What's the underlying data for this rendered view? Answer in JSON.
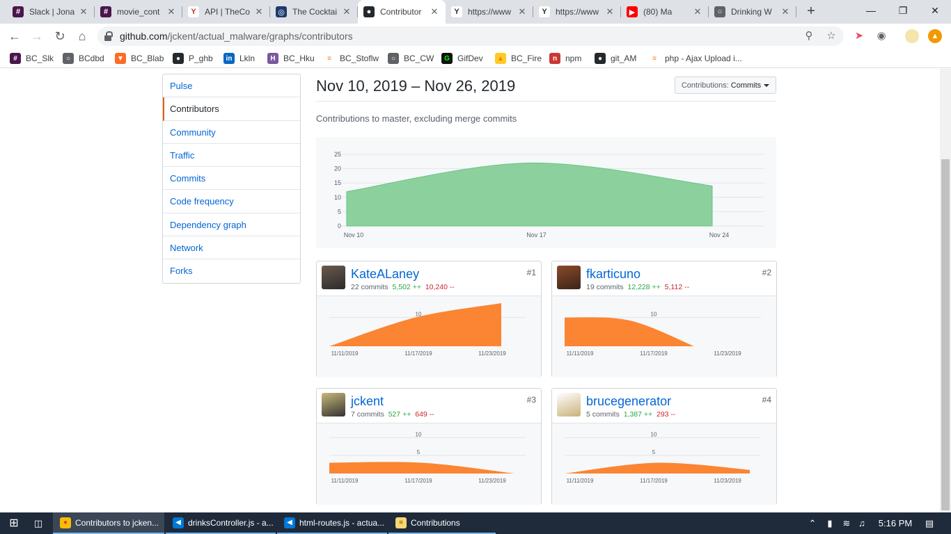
{
  "browser": {
    "tabs": [
      {
        "title": "Slack | Jona",
        "icon": "slack-icon",
        "x": 10,
        "w": 126,
        "active": false
      },
      {
        "title": "movie_cont",
        "icon": "slack-icon",
        "x": 136,
        "w": 126,
        "active": false
      },
      {
        "title": "API | TheCo",
        "icon": "cocktail-icon",
        "x": 262,
        "w": 126,
        "active": false
      },
      {
        "title": "The Cocktai",
        "icon": "cocktail-db-icon",
        "x": 388,
        "w": 126,
        "active": false
      },
      {
        "title": "Contributor",
        "icon": "github-icon",
        "x": 514,
        "w": 126,
        "active": true
      },
      {
        "title": "https://www",
        "icon": "cocktail-glass-icon",
        "x": 640,
        "w": 126,
        "active": false
      },
      {
        "title": "https://www",
        "icon": "cocktail-glass-icon",
        "x": 766,
        "w": 126,
        "active": false
      },
      {
        "title": "(80) Ma",
        "icon": "youtube-icon",
        "x": 892,
        "w": 126,
        "active": false
      },
      {
        "title": "Drinking W",
        "icon": "globe-icon",
        "x": 1018,
        "w": 126,
        "active": false
      }
    ],
    "url_host": "github.com",
    "url_path": "/jckent/actual_malware/graphs/contributors",
    "bookmarks": [
      {
        "label": "BC_Slk",
        "icon": "slack-icon",
        "x": 14
      },
      {
        "label": "BCdbd",
        "icon": "globe-icon",
        "x": 90
      },
      {
        "label": "BC_Blab",
        "icon": "gitlab-icon",
        "x": 165
      },
      {
        "label": "P_ghb",
        "icon": "github-icon",
        "x": 248
      },
      {
        "label": "Lkln",
        "icon": "linkedin-icon",
        "x": 321
      },
      {
        "label": "BC_Hku",
        "icon": "heroku-icon",
        "x": 384
      },
      {
        "label": "BC_Stoflw",
        "icon": "stackoverflow-icon",
        "x": 465
      },
      {
        "label": "BC_CW",
        "icon": "globe-icon",
        "x": 557
      },
      {
        "label": "GifDev",
        "icon": "gif-icon",
        "x": 634
      },
      {
        "label": "BC_Fire",
        "icon": "firebase-icon",
        "x": 711
      },
      {
        "label": "npm",
        "icon": "npm-icon",
        "x": 789
      },
      {
        "label": "git_AM",
        "icon": "github-icon",
        "x": 854
      },
      {
        "label": "php - Ajax Upload i...",
        "icon": "stackoverflow-icon",
        "x": 932
      }
    ]
  },
  "sidebar": {
    "items": [
      {
        "label": "Pulse",
        "selected": false
      },
      {
        "label": "Contributors",
        "selected": true
      },
      {
        "label": "Community",
        "selected": false
      },
      {
        "label": "Traffic",
        "selected": false
      },
      {
        "label": "Commits",
        "selected": false
      },
      {
        "label": "Code frequency",
        "selected": false
      },
      {
        "label": "Dependency graph",
        "selected": false
      },
      {
        "label": "Network",
        "selected": false
      },
      {
        "label": "Forks",
        "selected": false
      }
    ]
  },
  "main": {
    "date_range": "Nov 10, 2019 – Nov 26, 2019",
    "dropdown_prefix": "Contributions: ",
    "dropdown_value": "Commits",
    "subtitle": "Contributions to master, excluding merge commits"
  },
  "chart_data": [
    {
      "type": "area",
      "title": "",
      "x": [
        "Nov 10",
        "Nov 17",
        "Nov 24"
      ],
      "y": [
        12,
        22,
        14
      ],
      "yticks": [
        0,
        5,
        10,
        15,
        20,
        25
      ],
      "ylim": [
        0,
        25
      ],
      "color": "#8cd19d"
    },
    {
      "type": "area",
      "name": "KateALaney",
      "x": [
        "11/11/2019",
        "11/17/2019",
        "11/23/2019"
      ],
      "y": [
        0,
        10,
        15
      ],
      "yticks": [
        10
      ],
      "ylim": [
        0,
        15
      ],
      "color": "#fb8532"
    },
    {
      "type": "area",
      "name": "fkarticuno",
      "x": [
        "11/11/2019",
        "11/17/2019",
        "11/23/2019"
      ],
      "y": [
        10,
        9,
        0
      ],
      "yticks": [
        10
      ],
      "ylim": [
        0,
        15
      ],
      "color": "#fb8532"
    },
    {
      "type": "area",
      "name": "jckent",
      "x": [
        "11/11/2019",
        "11/17/2019",
        "11/23/2019"
      ],
      "y": [
        3,
        3,
        0
      ],
      "yticks": [
        10,
        5
      ],
      "ylim": [
        0,
        12
      ],
      "color": "#fb8532"
    },
    {
      "type": "area",
      "name": "brucegenerator",
      "x": [
        "11/11/2019",
        "11/17/2019",
        "11/23/2019"
      ],
      "y": [
        0,
        3,
        1
      ],
      "yticks": [
        10,
        5
      ],
      "ylim": [
        0,
        12
      ],
      "color": "#fb8532"
    }
  ],
  "contributors": [
    {
      "rank": "#1",
      "login": "KateALaney",
      "commits": "22 commits",
      "additions": "5,502 ++",
      "deletions": "10,240 --"
    },
    {
      "rank": "#2",
      "login": "fkarticuno",
      "commits": "19 commits",
      "additions": "12,228 ++",
      "deletions": "5,112 --"
    },
    {
      "rank": "#3",
      "login": "jckent",
      "commits": "7 commits",
      "additions": "527 ++",
      "deletions": "649 --"
    },
    {
      "rank": "#4",
      "login": "brucegenerator",
      "commits": "5 commits",
      "additions": "1,387 ++",
      "deletions": "293 --"
    }
  ],
  "taskbar": {
    "items": [
      {
        "label": "Contributors to jcken...",
        "icon": "chrome-icon"
      },
      {
        "label": "drinksController.js - a...",
        "icon": "vscode-icon"
      },
      {
        "label": "html-routes.js - actua...",
        "icon": "vscode-icon"
      },
      {
        "label": "Contributions",
        "icon": "folder-icon"
      }
    ],
    "clock": "5:16 PM"
  },
  "colors": {
    "link": "#0366d6",
    "accent": "#e36209",
    "green": "#28a745",
    "red": "#cb2431",
    "chart_green": "#8cd19d",
    "chart_orange": "#fb8532"
  }
}
